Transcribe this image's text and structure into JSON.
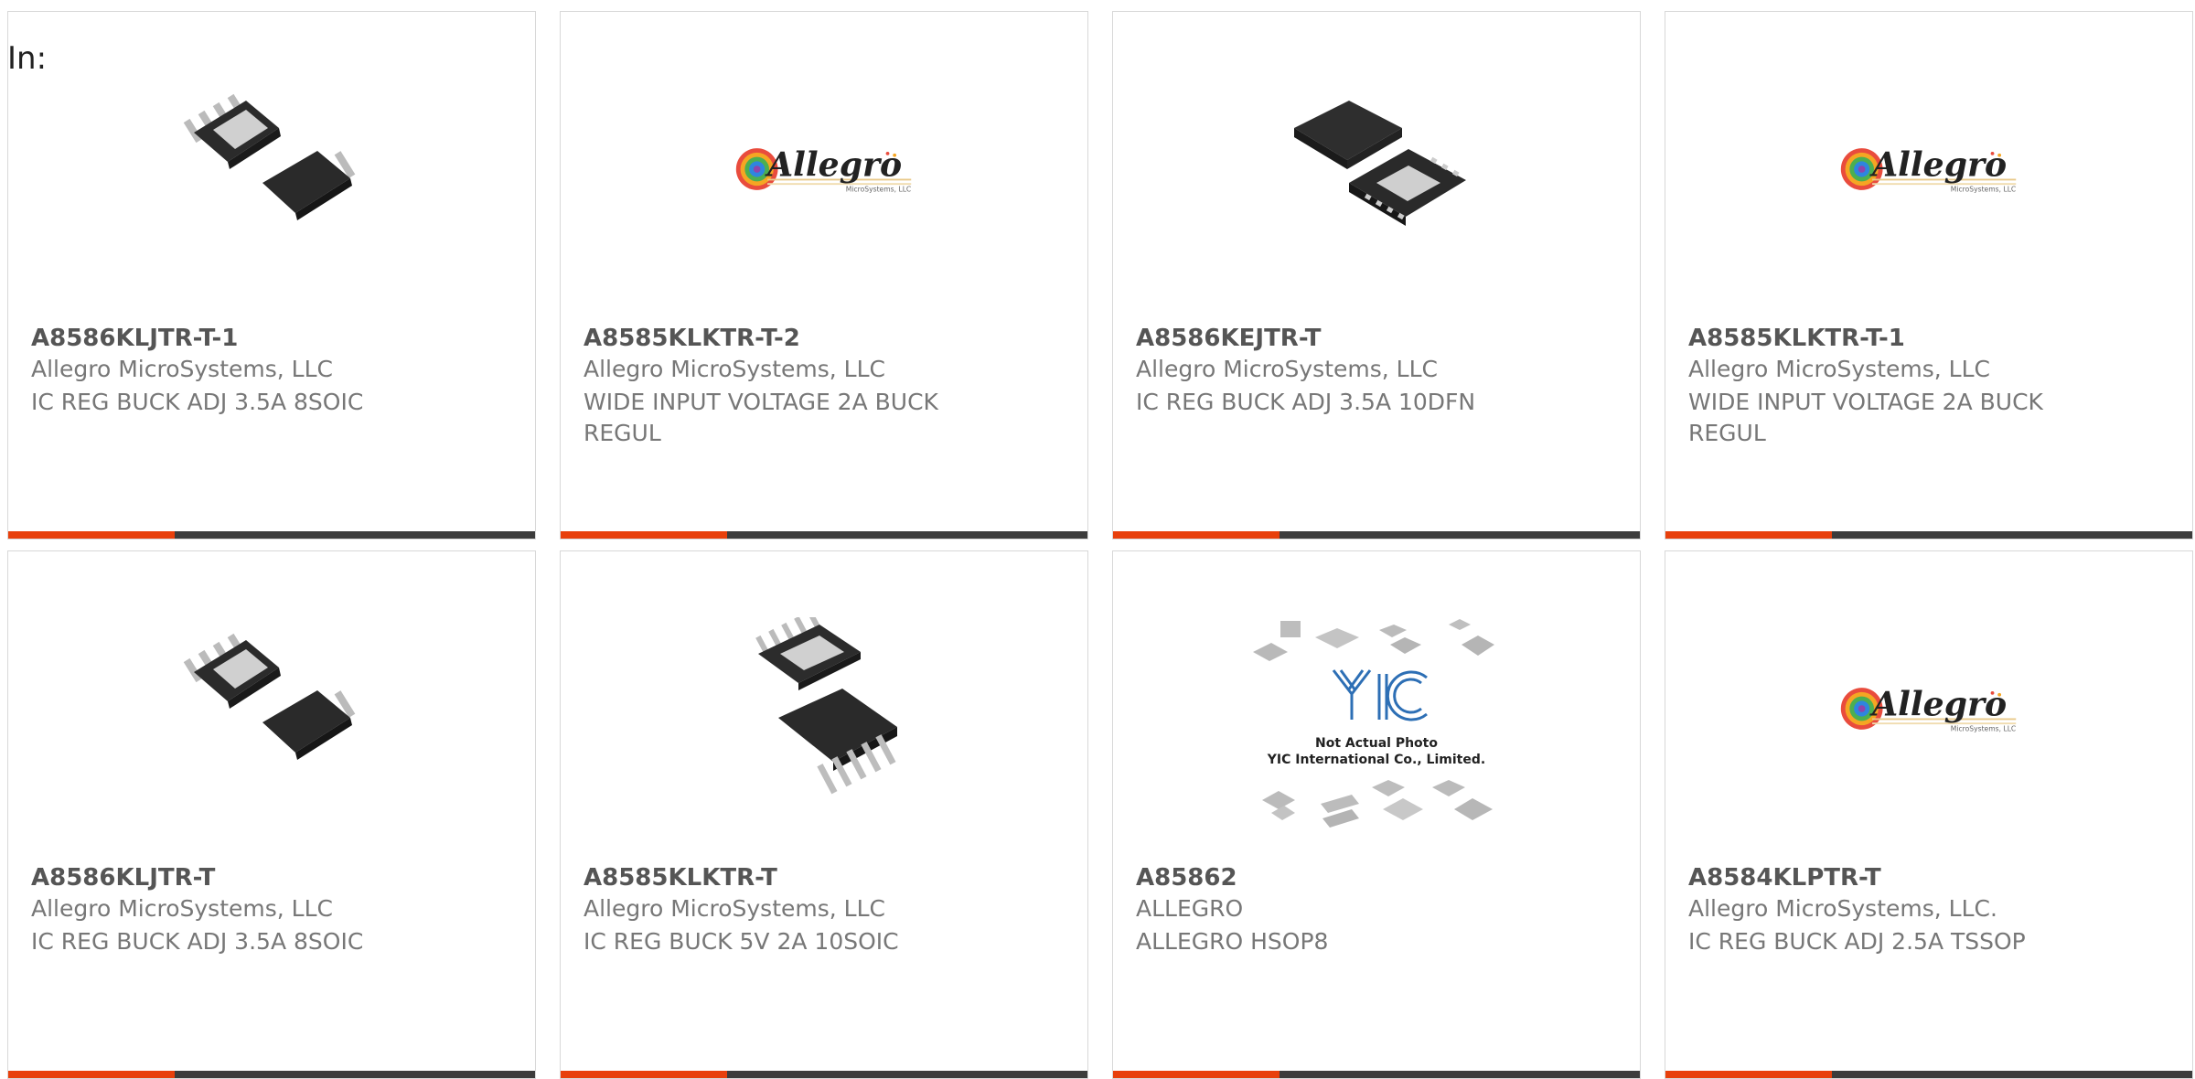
{
  "filter_label": "In:",
  "colors": {
    "accent": "#e8400c",
    "bar": "#3c3c3c",
    "text": "#777777"
  },
  "products": [
    {
      "part": "A8586KLJTR-T-1",
      "manufacturer": "Allegro MicroSystems, LLC",
      "description": "IC REG BUCK ADJ 3.5A 8SOIC",
      "image": "soic8-chip-icon"
    },
    {
      "part": "A8585KLKTR-T-2",
      "manufacturer": "Allegro MicroSystems, LLC",
      "description": "WIDE INPUT VOLTAGE 2A BUCK REGUL",
      "image": "allegro-logo",
      "logo_text": "Allegro",
      "logo_sub": "MicroSystems, LLC"
    },
    {
      "part": "A8586KEJTR-T",
      "manufacturer": "Allegro MicroSystems, LLC",
      "description": "IC REG BUCK ADJ 3.5A 10DFN",
      "image": "dfn10-chip-icon"
    },
    {
      "part": "A8585KLKTR-T-1",
      "manufacturer": "Allegro MicroSystems, LLC",
      "description": "WIDE INPUT VOLTAGE 2A BUCK REGUL",
      "image": "allegro-logo",
      "logo_text": "Allegro",
      "logo_sub": "MicroSystems, LLC"
    },
    {
      "part": "A8586KLJTR-T",
      "manufacturer": "Allegro MicroSystems, LLC",
      "description": "IC REG BUCK ADJ 3.5A 8SOIC",
      "image": "soic8-chip-icon"
    },
    {
      "part": "A8585KLKTR-T",
      "manufacturer": "Allegro MicroSystems, LLC",
      "description": "IC REG BUCK 5V 2A 10SOIC",
      "image": "soic10-chip-icon"
    },
    {
      "part": "A85862",
      "manufacturer": "ALLEGRO",
      "description": "ALLEGRO HSOP8",
      "image": "yic-placeholder",
      "yic_line1": "Not Actual Photo",
      "yic_line2": "YIC International Co., Limited."
    },
    {
      "part": "A8584KLPTR-T",
      "manufacturer": "Allegro MicroSystems, LLC.",
      "description": "IC REG BUCK ADJ 2.5A TSSOP",
      "image": "allegro-logo",
      "logo_text": "Allegro",
      "logo_sub": "MicroSystems, LLC"
    }
  ]
}
